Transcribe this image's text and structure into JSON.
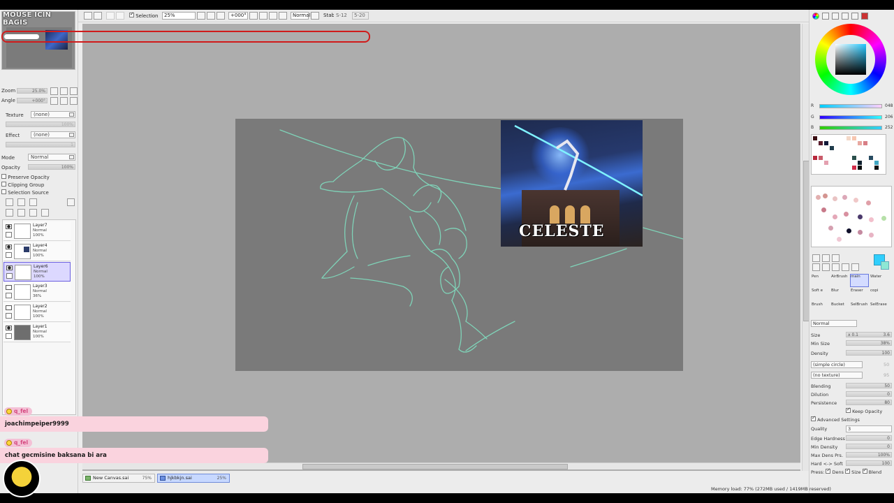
{
  "stream": {
    "title": "MOUSE ICIN BAGIS"
  },
  "toolbar": {
    "selection_label": "Selection",
    "zoom_value": "25%",
    "angle_value": "+000°",
    "mode_value": "Normal",
    "stab_label": "Stab",
    "stab_value": "S-12",
    "stab_extra": "5-20"
  },
  "navigator": {
    "zoom_label": "Zoom",
    "zoom_value": "25.0%",
    "angle_label": "Angle",
    "angle_value": "+000°"
  },
  "layer_props": {
    "texture_label": "Texture",
    "texture_value": "(none)",
    "scale_label": "Scale",
    "scale_value": "100%",
    "effect_label": "Effect",
    "effect_value": "(none)",
    "width_label": "Width",
    "width_value": "1",
    "mode_label": "Mode",
    "mode_value": "Normal",
    "opacity_label": "Opacity",
    "opacity_value": "100%",
    "preserve_opacity": "Preserve Opacity",
    "clipping_group": "Clipping Group",
    "selection_source": "Selection Source"
  },
  "layers": [
    {
      "name": "Layer7",
      "mode": "Normal",
      "opacity": "100%"
    },
    {
      "name": "Layer4",
      "mode": "Normal",
      "opacity": "100%"
    },
    {
      "name": "Layer6",
      "mode": "Normal",
      "opacity": "100%"
    },
    {
      "name": "Layer3",
      "mode": "Normal",
      "opacity": "36%"
    },
    {
      "name": "Layer2",
      "mode": "Normal",
      "opacity": "100%"
    },
    {
      "name": "Layer1",
      "mode": "Normal",
      "opacity": "100%"
    }
  ],
  "reference_image": {
    "logo_text": "CELESTE"
  },
  "documents": [
    {
      "name": "New Canvas.sai",
      "zoom": "75%"
    },
    {
      "name": "hjkbkjn.sai",
      "zoom": "25%"
    }
  ],
  "chat": [
    {
      "user": "q_fel",
      "message": "joachimpeiper9999"
    },
    {
      "user": "q_fel",
      "message": "chat gecmisine baksana bi ara"
    }
  ],
  "color": {
    "r_label": "R",
    "r_value": "048",
    "g_label": "G",
    "g_value": "206",
    "b_label": "B",
    "b_value": "252",
    "current_hex": "#30cefc"
  },
  "tools": [
    "Pen",
    "AirBrush",
    "main",
    "Water",
    "Soft e",
    "Blur",
    "Eraser",
    "copi",
    "Brush",
    "Bucket",
    "SelBrush",
    "SelErase"
  ],
  "brush": {
    "blend_mode": "Normal",
    "size_label": "Size",
    "size_mult": "x 0.1",
    "size_value": "3.6",
    "min_size_label": "Min Size",
    "min_size_value": "38%",
    "density_label": "Density",
    "density_value": "100",
    "shape_value": "(simple circle)",
    "shape_num": "50",
    "texture_value": "(no texture)",
    "texture_num": "95",
    "blending_label": "Blending",
    "blending_value": "50",
    "dilution_label": "Dilution",
    "dilution_value": "0",
    "persistence_label": "Persistence",
    "persistence_value": "80",
    "keep_opacity": "Keep Opacity",
    "advanced_settings": "Advanced Settings",
    "quality_label": "Quality",
    "quality_value": "3",
    "edge_hardness_label": "Edge Hardness",
    "edge_hardness_value": "0",
    "min_density_label": "Min Density",
    "min_density_value": "0",
    "max_dens_prs_label": "Max Dens Prs.",
    "max_dens_prs_value": "100%",
    "hard_soft_label": "Hard <-> Soft",
    "hard_soft_value": "100",
    "press_label": "Press:",
    "press_dens": "Dens",
    "press_size": "Size",
    "press_blend": "Blend"
  },
  "status": {
    "memory": "Memory load: 77% (272MB used / 1419MB reserved)"
  }
}
